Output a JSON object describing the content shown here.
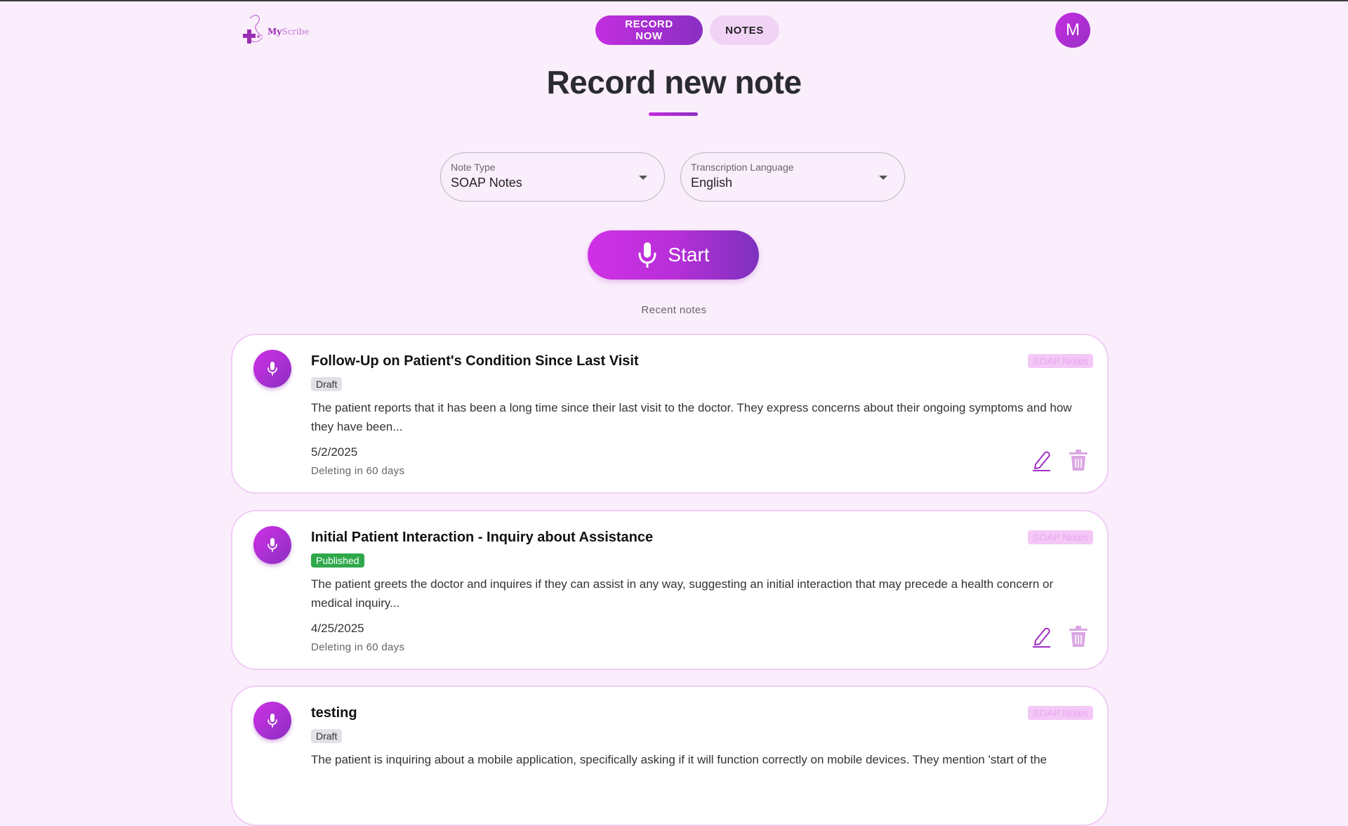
{
  "app": {
    "logo_text_my": "My",
    "logo_text_scribe": "Scribe"
  },
  "nav": {
    "record_now": "RECORD NOW",
    "notes": "NOTES"
  },
  "user": {
    "avatar_initial": "M"
  },
  "page": {
    "title": "Record new note"
  },
  "form": {
    "note_type_label": "Note Type",
    "note_type_value": "SOAP Notes",
    "language_label": "Transcription Language",
    "language_value": "English"
  },
  "start_button": {
    "label": "Start"
  },
  "recent": {
    "label": "Recent notes",
    "notes": [
      {
        "title": "Follow-Up on Patient's Condition Since Last Visit",
        "status": "Draft",
        "type": "SOAP Notes",
        "description": "The patient reports that it has been a long time since their last visit to the doctor. They express concerns about their ongoing symptoms and how they have been...",
        "date": "5/2/2025",
        "deleting": "Deleting in 60 days"
      },
      {
        "title": "Initial Patient Interaction - Inquiry about Assistance",
        "status": "Published",
        "type": "SOAP Notes",
        "description": "The patient greets the doctor and inquires if they can assist in any way, suggesting an initial interaction that may precede a health concern or medical inquiry...",
        "date": "4/25/2025",
        "deleting": "Deleting in 60 days"
      },
      {
        "title": "testing",
        "status": "Draft",
        "type": "SOAP Notes",
        "description": "The patient is inquiring about a mobile application, specifically asking if it will function correctly on mobile devices. They mention 'start of the",
        "date": "",
        "deleting": ""
      }
    ]
  },
  "icons": {
    "mic": "microphone-icon",
    "edit": "pencil-icon",
    "delete": "trash-icon",
    "dropdown": "caret-down-icon"
  },
  "colors": {
    "accent_start": "#c42ee0",
    "accent_end": "#8a2fc2",
    "background": "#fbeefc",
    "published": "#2ea84a"
  }
}
